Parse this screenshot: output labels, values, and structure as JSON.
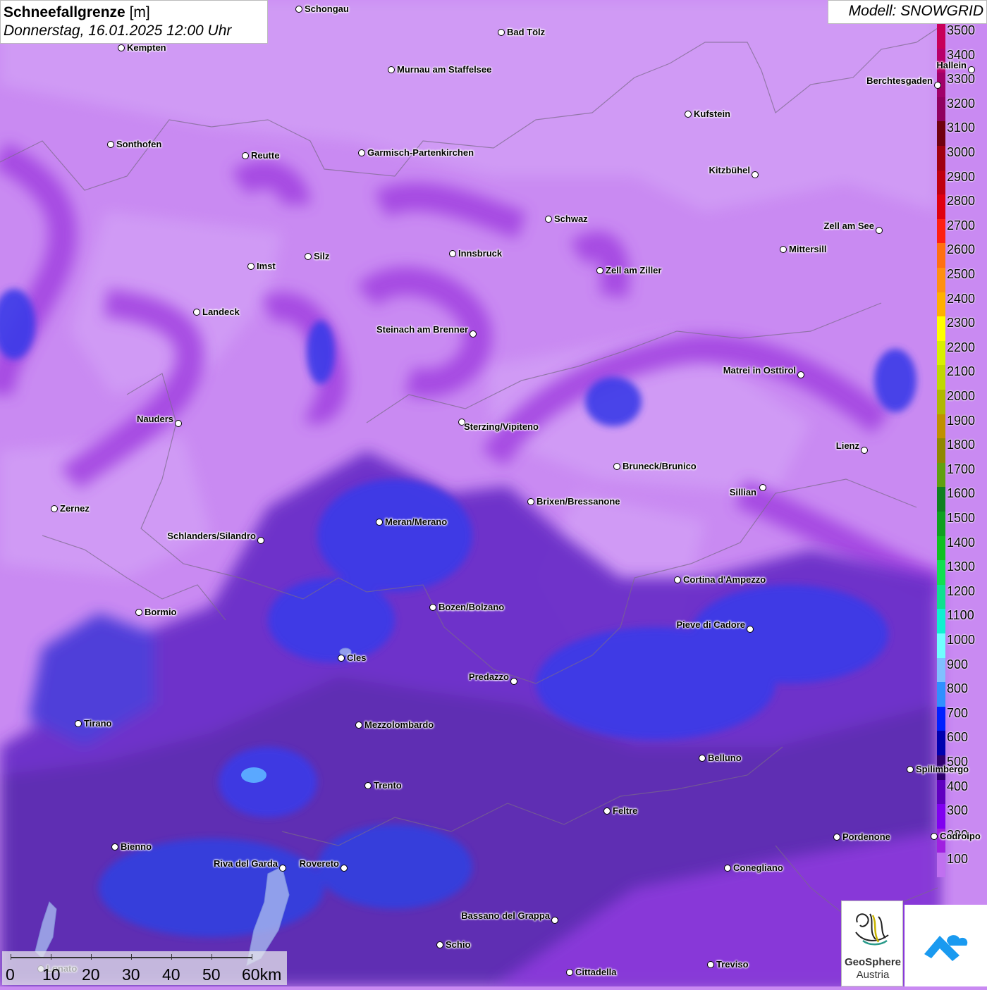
{
  "header": {
    "title_bold": "Schneefallgrenze",
    "title_unit": "[m]",
    "datetime": "Donnerstag, 16.01.2025 12:00 Uhr",
    "model": "Modell: SNOWGRID"
  },
  "legend": {
    "levels": [
      {
        "label": "3500",
        "color": "#c8005a"
      },
      {
        "label": "3400",
        "color": "#b8006a"
      },
      {
        "label": "3300",
        "color": "#a0006a"
      },
      {
        "label": "3200",
        "color": "#900060"
      },
      {
        "label": "3100",
        "color": "#700010"
      },
      {
        "label": "3000",
        "color": "#a00010"
      },
      {
        "label": "2900",
        "color": "#c00010"
      },
      {
        "label": "2800",
        "color": "#e00010"
      },
      {
        "label": "2700",
        "color": "#ff2010"
      },
      {
        "label": "2600",
        "color": "#ff7010"
      },
      {
        "label": "2500",
        "color": "#ff9010"
      },
      {
        "label": "2400",
        "color": "#ffb000"
      },
      {
        "label": "2300",
        "color": "#ffff00"
      },
      {
        "label": "2200",
        "color": "#d8f000"
      },
      {
        "label": "2100",
        "color": "#c0d800"
      },
      {
        "label": "2000",
        "color": "#b0b800"
      },
      {
        "label": "1900",
        "color": "#c09000"
      },
      {
        "label": "1800",
        "color": "#908800"
      },
      {
        "label": "1700",
        "color": "#60a010"
      },
      {
        "label": "1600",
        "color": "#108020"
      },
      {
        "label": "1500",
        "color": "#10a020"
      },
      {
        "label": "1400",
        "color": "#10c020"
      },
      {
        "label": "1300",
        "color": "#10e050"
      },
      {
        "label": "1200",
        "color": "#10e090"
      },
      {
        "label": "1100",
        "color": "#10f0d0"
      },
      {
        "label": "1000",
        "color": "#70ffff"
      },
      {
        "label": "900",
        "color": "#80c0ff"
      },
      {
        "label": "800",
        "color": "#3090ff"
      },
      {
        "label": "700",
        "color": "#0020ff"
      },
      {
        "label": "600",
        "color": "#0000b0"
      },
      {
        "label": "500",
        "color": "#300070"
      },
      {
        "label": "400",
        "color": "#6000c0"
      },
      {
        "label": "300",
        "color": "#8000f0"
      },
      {
        "label": "200",
        "color": "#a020e0"
      },
      {
        "label": "100",
        "color": "#c070f0"
      }
    ]
  },
  "cities": [
    {
      "name": "Schongau"
    },
    {
      "name": "Bad Tölz"
    },
    {
      "name": "Kempten"
    },
    {
      "name": "Murnau am Staffelsee"
    },
    {
      "name": "Hallein"
    },
    {
      "name": "Berchtesgaden"
    },
    {
      "name": "Kufstein"
    },
    {
      "name": "Sonthofen"
    },
    {
      "name": "Reutte"
    },
    {
      "name": "Garmisch-Partenkirchen"
    },
    {
      "name": "Kitzbühel"
    },
    {
      "name": "Schwaz"
    },
    {
      "name": "Zell am See"
    },
    {
      "name": "Mittersill"
    },
    {
      "name": "Innsbruck"
    },
    {
      "name": "Silz"
    },
    {
      "name": "Imst"
    },
    {
      "name": "Zell am Ziller"
    },
    {
      "name": "Landeck"
    },
    {
      "name": "Steinach am Brenner"
    },
    {
      "name": "Matrei in Osttirol"
    },
    {
      "name": "Nauders"
    },
    {
      "name": "Sterzing/Vipiteno"
    },
    {
      "name": "Lienz"
    },
    {
      "name": "Bruneck/Brunico"
    },
    {
      "name": "Sillian"
    },
    {
      "name": "Zernez"
    },
    {
      "name": "Brixen/Bressanone"
    },
    {
      "name": "Meran/Merano"
    },
    {
      "name": "Schlanders/Silandro"
    },
    {
      "name": "Cortina d'Ampezzo"
    },
    {
      "name": "Bozen/Bolzano"
    },
    {
      "name": "Bormio"
    },
    {
      "name": "Pieve di Cadore"
    },
    {
      "name": "Cles"
    },
    {
      "name": "Predazzo"
    },
    {
      "name": "Tirano"
    },
    {
      "name": "Mezzolombardo"
    },
    {
      "name": "Belluno"
    },
    {
      "name": "Spilimbergo"
    },
    {
      "name": "Trento"
    },
    {
      "name": "Feltre"
    },
    {
      "name": "Bienno"
    },
    {
      "name": "Pordenone"
    },
    {
      "name": "Codroipo"
    },
    {
      "name": "Riva del Garda"
    },
    {
      "name": "Rovereto"
    },
    {
      "name": "Conegliano"
    },
    {
      "name": "Bassano del Grappa"
    },
    {
      "name": "Schio"
    },
    {
      "name": "Treviso"
    },
    {
      "name": "Cittadella"
    },
    {
      "name": "Lonato"
    }
  ],
  "scale": {
    "ticks": [
      "0",
      "10",
      "20",
      "30",
      "40",
      "50",
      "60km"
    ]
  },
  "logos": {
    "geosphere_line1": "GeoSphere",
    "geosphere_line2": "Austria"
  }
}
